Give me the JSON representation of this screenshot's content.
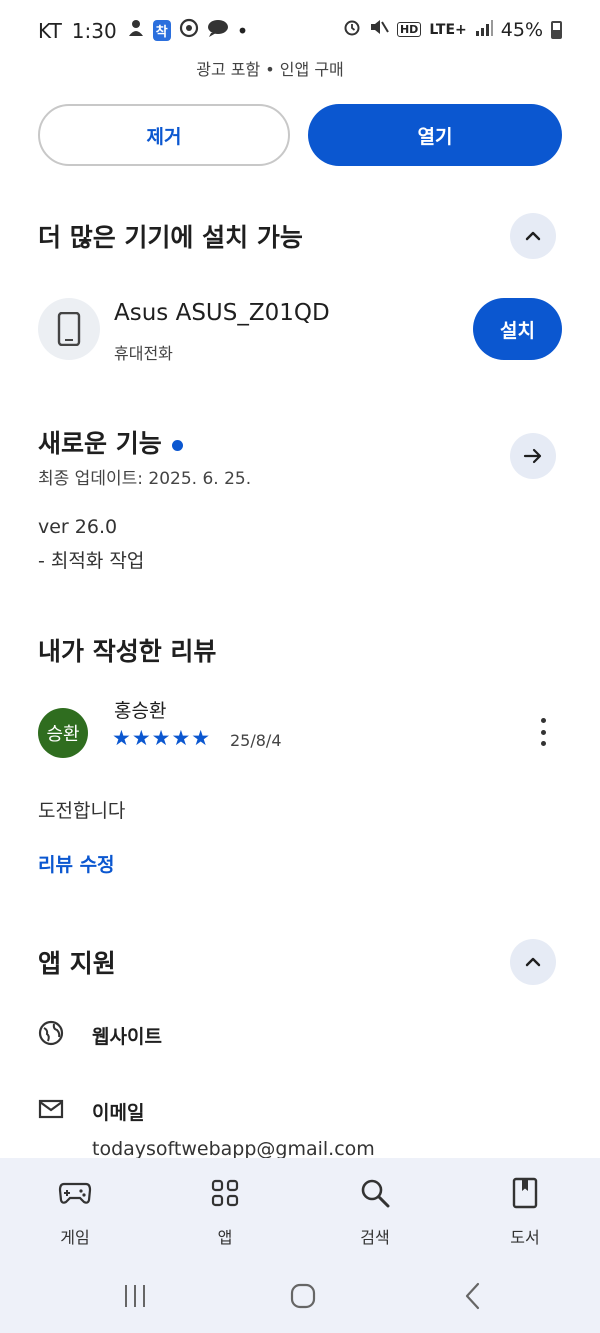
{
  "status_bar": {
    "carrier": "KT",
    "time": "1:30",
    "notif_badge": "착",
    "network": "LTE+",
    "battery": "45%"
  },
  "ad_note": "광고 포함 • 인앱 구매",
  "actions": {
    "uninstall_label": "제거",
    "open_label": "열기"
  },
  "more_devices": {
    "title": "더 많은 기기에 설치 가능",
    "device_name": "Asus ASUS_Z01QD",
    "device_type": "휴대전화",
    "install_label": "설치"
  },
  "whats_new": {
    "title": "새로운 기능",
    "last_updated": "최종 업데이트: 2025. 6. 25.",
    "version": "ver 26.0",
    "notes": "- 최적화 작업"
  },
  "my_review": {
    "title": "내가 작성한 리뷰",
    "avatar_text": "승환",
    "reviewer_name": "홍승환",
    "stars_display": "★★★★★",
    "rating": 5,
    "date": "25/8/4",
    "text": "도전합니다",
    "edit_label": "리뷰 수정"
  },
  "app_support": {
    "title": "앱 지원",
    "website_label": "웹사이트",
    "email_label": "이메일",
    "email_value": "todaysoftwebapp@gmail.com"
  },
  "bottom_nav": {
    "items": [
      {
        "label": "게임",
        "icon": "gamepad-icon"
      },
      {
        "label": "앱",
        "icon": "apps-grid-icon"
      },
      {
        "label": "검색",
        "icon": "search-icon"
      },
      {
        "label": "도서",
        "icon": "book-icon"
      }
    ]
  },
  "colors": {
    "accent": "#0b57d0",
    "avatar_bg": "#2f6d1f",
    "nav_bg": "#eef1f9"
  }
}
